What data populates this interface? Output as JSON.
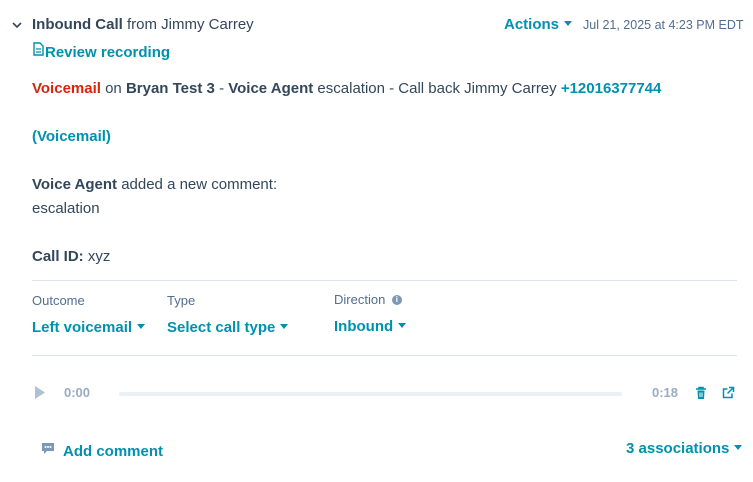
{
  "header": {
    "type": "Inbound Call",
    "from_word": "from",
    "contact": "Jimmy Carrey",
    "actions_label": "Actions",
    "timestamp": "Jul 21, 2025 at 4:23 PM EDT"
  },
  "review_recording_label": "Review recording",
  "summary": {
    "voicemail_label": "Voicemail",
    "on_word": "on",
    "agent_name": "Bryan Test 3",
    "dash": "-",
    "voice_agent": "Voice Agent",
    "message": "escalation - Call back Jimmy Carrey",
    "phone": "+12016377744"
  },
  "voicemail_link": "(Voicemail)",
  "comment": {
    "author": "Voice Agent",
    "action": "added a new comment:",
    "text": "escalation"
  },
  "call_id": {
    "label": "Call ID:",
    "value": "xyz"
  },
  "fields": {
    "outcome_label": "Outcome",
    "outcome_value": "Left voicemail",
    "type_label": "Type",
    "type_value": "Select call type",
    "direction_label": "Direction",
    "direction_value": "Inbound"
  },
  "player": {
    "current_time": "0:00",
    "duration": "0:18",
    "progress": 0
  },
  "footer": {
    "add_comment_label": "Add comment",
    "associations_label": "3 associations"
  },
  "colors": {
    "accent": "#0091ae",
    "voicemail_red": "#d9230f",
    "text": "#33475b",
    "muted": "#99acc2"
  },
  "icons": [
    "chevron-down-icon",
    "document-icon",
    "info-icon",
    "play-icon",
    "trash-icon",
    "external-link-icon",
    "comment-icon"
  ]
}
